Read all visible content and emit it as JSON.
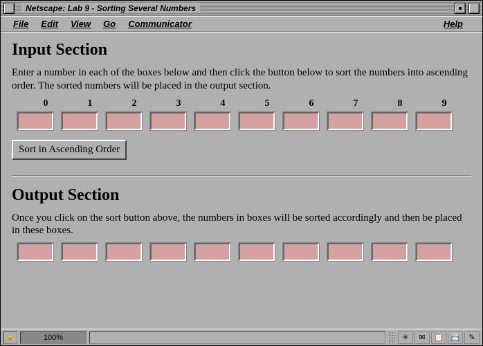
{
  "window": {
    "title": "Netscape: Lab 9 - Sorting Several Numbers"
  },
  "menu": {
    "file": "File",
    "edit": "Edit",
    "view": "View",
    "go": "Go",
    "communicator": "Communicator",
    "help": "Help"
  },
  "input_section": {
    "heading": "Input Section",
    "desc": "Enter a number in each of the boxes below and then click the button below to sort the numbers into ascending order. The sorted numbers will be placed in the output section.",
    "labels": [
      "0",
      "1",
      "2",
      "3",
      "4",
      "5",
      "6",
      "7",
      "8",
      "9"
    ],
    "values": [
      "",
      "",
      "",
      "",
      "",
      "",
      "",
      "",
      "",
      ""
    ],
    "button_label": "Sort in Ascending Order"
  },
  "output_section": {
    "heading": "Output Section",
    "desc": "Once you click on the sort button above, the numbers in boxes will be sorted accordingly and then be placed in these boxes.",
    "values": [
      "",
      "",
      "",
      "",
      "",
      "",
      "",
      "",
      "",
      ""
    ]
  },
  "status": {
    "progress": "100%"
  }
}
